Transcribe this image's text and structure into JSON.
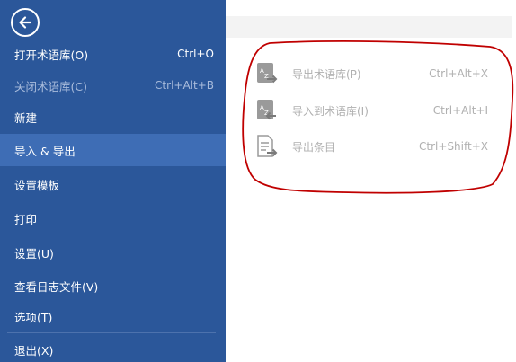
{
  "sidebar": {
    "back_icon": "back-arrow-icon",
    "items": [
      {
        "label": "打开术语库(O)",
        "shortcut": "Ctrl+O",
        "state": "normal"
      },
      {
        "label": "关闭术语库(C)",
        "shortcut": "Ctrl+Alt+B",
        "state": "disabled"
      },
      {
        "label": "新建",
        "shortcut": "",
        "state": "normal"
      },
      {
        "label": "导入 & 导出",
        "shortcut": "",
        "state": "selected"
      },
      {
        "label": "设置模板",
        "shortcut": "",
        "state": "normal"
      },
      {
        "label": "打印",
        "shortcut": "",
        "state": "normal"
      },
      {
        "label": "设置(U)",
        "shortcut": "",
        "state": "normal"
      },
      {
        "label": "查看日志文件(V)",
        "shortcut": "",
        "state": "normal"
      },
      {
        "label": "选项(T)",
        "shortcut": "",
        "state": "normal"
      },
      {
        "label": "退出(X)",
        "shortcut": "",
        "state": "normal"
      }
    ]
  },
  "submenu": {
    "items": [
      {
        "label": "导出术语库(P)",
        "shortcut": "Ctrl+Alt+X",
        "icon": "export-termbase-icon"
      },
      {
        "label": "导入到术语库(I)",
        "shortcut": "Ctrl+Alt+I",
        "icon": "import-termbase-icon"
      },
      {
        "label": "导出条目",
        "shortcut": "Ctrl+Shift+X",
        "icon": "export-entries-icon"
      }
    ]
  },
  "colors": {
    "sidebar_bg": "#2b579a",
    "selected_bg": "#3e6db5",
    "disabled_text": "#a9bcdc",
    "submenu_text": "#b0b0b0",
    "annotation_stroke": "#c00000"
  }
}
